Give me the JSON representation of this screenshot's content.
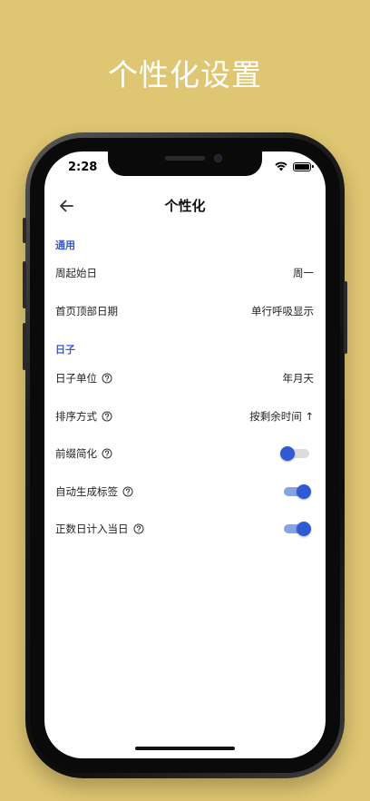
{
  "promo": {
    "title": "个性化设置"
  },
  "status_bar": {
    "time": "2:28",
    "icons": [
      "wifi-icon",
      "battery-icon"
    ]
  },
  "app_bar": {
    "title": "个性化",
    "back_icon": "arrow-left-icon"
  },
  "sections": {
    "general": {
      "header": "通用",
      "week_start": {
        "label": "周起始日",
        "value": "周一"
      },
      "home_date": {
        "label": "首页顶部日期",
        "value": "单行呼吸显示"
      }
    },
    "days": {
      "header": "日子",
      "unit": {
        "label": "日子单位",
        "value": "年月天"
      },
      "sort": {
        "label": "排序方式",
        "value": "按剩余时间 ↑"
      },
      "prefix_simplify": {
        "label": "前缀简化",
        "enabled": false
      },
      "auto_tags": {
        "label": "自动生成标签",
        "enabled": true
      },
      "count_today": {
        "label": "正数日计入当日",
        "enabled": true
      }
    }
  },
  "colors": {
    "background": "#dfc672",
    "accent": "#3059d4",
    "accent_track": "#88a2e6",
    "section_header": "#2f5bd6"
  }
}
